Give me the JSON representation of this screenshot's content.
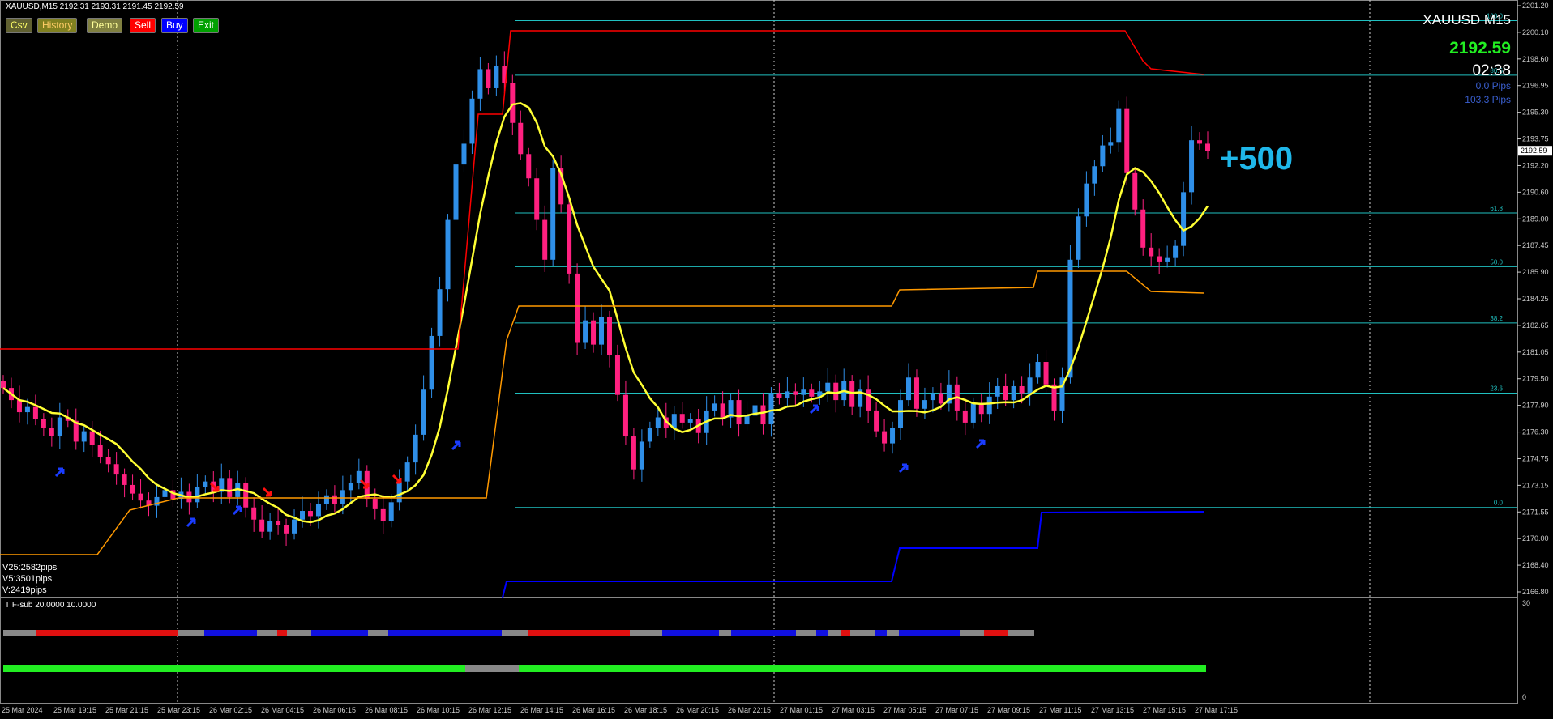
{
  "header": {
    "title": "XAUUSD,M15  2192.31 2193.31 2191.45 2192.59",
    "buttons": [
      {
        "label": "Csv",
        "bg": "#606030",
        "fg": "#ffff66"
      },
      {
        "label": "History",
        "bg": "#808020",
        "fg": "#ffcc66"
      },
      {
        "label": "Demo",
        "bg": "#808040",
        "fg": "#ffff99"
      },
      {
        "label": "Sell",
        "bg": "#ff0000",
        "fg": "#ffffff"
      },
      {
        "label": "Buy",
        "bg": "#0000ff",
        "fg": "#ffffff"
      },
      {
        "label": "Exit",
        "bg": "#00a000",
        "fg": "#ffffff"
      }
    ]
  },
  "info": {
    "symbol": "XAUUSD M15",
    "price": "2192.59",
    "timer": "02:38",
    "spread": "0.0 Pips",
    "range": "103.3 Pips",
    "big_pips": "+500"
  },
  "stats": [
    "V25:2582pips",
    "V5:3501pips",
    "V:2419pips"
  ],
  "subwindow": {
    "label": "TIF-sub 20.0000 10.0000",
    "top_value": "30",
    "bottom_value": "0"
  },
  "price_axis": {
    "labels": [
      "2201.20",
      "2200.10",
      "2198.60",
      "2196.95",
      "2195.30",
      "2193.75",
      "2192.20",
      "2190.60",
      "2189.00",
      "2187.45",
      "2185.90",
      "2184.25",
      "2182.65",
      "2181.05",
      "2179.50",
      "2177.90",
      "2176.30",
      "2174.75",
      "2173.15",
      "2171.55",
      "2170.00",
      "2168.40",
      "2166.80"
    ],
    "current": "2192.59",
    "min": 2166.8,
    "max": 2201.2
  },
  "time_axis": [
    "25 Mar 2024",
    "25 Mar 19:15",
    "25 Mar 21:15",
    "25 Mar 23:15",
    "26 Mar 02:15",
    "26 Mar 04:15",
    "26 Mar 06:15",
    "26 Mar 08:15",
    "26 Mar 10:15",
    "26 Mar 12:15",
    "26 Mar 14:15",
    "26 Mar 16:15",
    "26 Mar 18:15",
    "26 Mar 20:15",
    "26 Mar 22:15",
    "27 Mar 01:15",
    "27 Mar 03:15",
    "27 Mar 05:15",
    "27 Mar 07:15",
    "27 Mar 09:15",
    "27 Mar 11:15",
    "27 Mar 13:15",
    "27 Mar 15:15",
    "27 Mar 17:15"
  ],
  "fibo": [
    {
      "label": "100.0",
      "price": 2200.1
    },
    {
      "label": "86.6",
      "price": 2196.95
    },
    {
      "label": "61.8",
      "price": 2189.0
    },
    {
      "label": "50.0",
      "price": 2185.9
    },
    {
      "label": "38.2",
      "price": 2182.65
    },
    {
      "label": "23.6",
      "price": 2178.6
    },
    {
      "label": "0.0",
      "price": 2172.0
    }
  ],
  "colors": {
    "bull": "#2f8fe8",
    "bear": "#ff2080",
    "ma": "#ffff33",
    "upper": "#ff0000",
    "lower": "#0000ff",
    "mid": "#ff9900",
    "fibo": "#20c0c0"
  },
  "chart_data": {
    "type": "candlestick",
    "closes": [
      2178.9,
      2178.2,
      2177.5,
      2177.8,
      2177.1,
      2176.6,
      2176.1,
      2177.2,
      2177.0,
      2175.8,
      2176.4,
      2175.6,
      2174.9,
      2174.5,
      2173.9,
      2173.3,
      2172.8,
      2172.4,
      2172.1,
      2172.6,
      2173.0,
      2172.5,
      2172.9,
      2172.3,
      2173.2,
      2173.5,
      2172.9,
      2173.7,
      2172.6,
      2173.4,
      2172.0,
      2171.3,
      2170.6,
      2171.2,
      2171.0,
      2170.5,
      2171.3,
      2171.8,
      2171.5,
      2172.2,
      2172.7,
      2172.2,
      2173.0,
      2173.4,
      2174.1,
      2172.5,
      2171.9,
      2171.2,
      2172.3,
      2173.5,
      2174.6,
      2176.2,
      2178.8,
      2181.9,
      2184.6,
      2188.6,
      2191.8,
      2193.0,
      2195.6,
      2197.3,
      2196.2,
      2197.5,
      2196.5,
      2194.2,
      2192.4,
      2191.0,
      2188.6,
      2186.3,
      2191.6,
      2189.5,
      2185.5,
      2181.5,
      2182.8,
      2181.4,
      2183.0,
      2180.8,
      2178.5,
      2176.1,
      2174.2,
      2175.8,
      2176.6,
      2177.2,
      2176.6,
      2177.4,
      2176.9,
      2177.1,
      2176.3,
      2177.6,
      2178.0,
      2177.2,
      2178.2,
      2176.8,
      2177.3,
      2177.9,
      2176.8,
      2178.6,
      2178.3,
      2178.7,
      2178.5,
      2178.8,
      2178.4,
      2178.7,
      2179.2,
      2178.2,
      2179.3,
      2177.8,
      2178.8,
      2177.6,
      2176.4,
      2175.7,
      2176.6,
      2178.2,
      2179.5,
      2177.7,
      2178.2,
      2178.6,
      2178.0,
      2179.1,
      2177.6,
      2176.9,
      2178.0,
      2177.4,
      2178.4,
      2179.0,
      2178.2,
      2179.0,
      2178.6,
      2179.5,
      2180.4,
      2179.1,
      2177.6,
      2179.5,
      2186.3,
      2188.8,
      2190.7,
      2191.7,
      2192.9,
      2193.1,
      2195.0,
      2191.3,
      2189.2,
      2187.0,
      2186.5,
      2186.2,
      2186.4,
      2187.1,
      2190.2,
      2193.2,
      2193.0,
      2192.6
    ],
    "ylim": [
      2166.8,
      2201.2
    ]
  }
}
